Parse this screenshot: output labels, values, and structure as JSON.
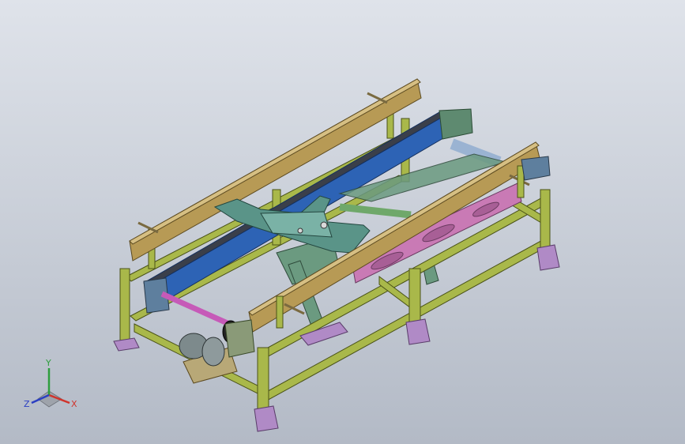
{
  "viewport": {
    "background_top": "#dfe3ea",
    "background_bottom": "#b3bac6"
  },
  "model": {
    "frame_color": "#a9b84a",
    "frame_dark": "#6f7a2a",
    "rail_color": "#b79a55",
    "belt_color": "#2d63b5",
    "support_color": "#6b9a80",
    "panel_color": "#c97ab5",
    "foot_color": "#b08ac6",
    "shaft_color": "#c65ab8",
    "roller_color": "#9ab3d2"
  },
  "triad": {
    "x_label": "X",
    "y_label": "Y",
    "z_label": "Z",
    "x_color": "#d0342c",
    "y_color": "#2e9e3e",
    "z_color": "#2b3fc2"
  }
}
